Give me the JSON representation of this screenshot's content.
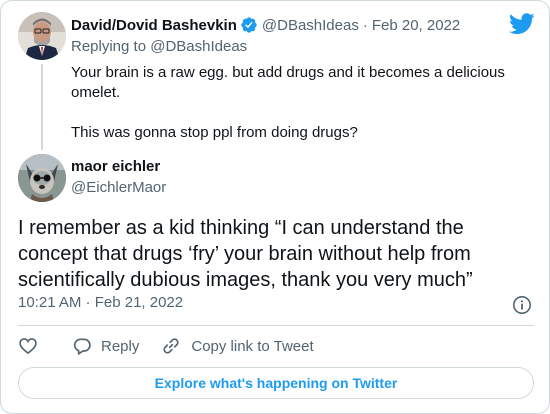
{
  "brand": {
    "icon": "twitter-bird-icon",
    "color": "#1d9bf0"
  },
  "parent_tweet": {
    "author_name": "David/Dovid Bashevkin",
    "verified_icon": "verified-badge-icon",
    "handle": "@DBashIdeas",
    "separator": "·",
    "date": "Feb 20, 2022",
    "replying_to": "Replying to @DBashIdeas",
    "paragraph_1": "Your brain is a raw egg. but add drugs and it becomes a delicious omelet.",
    "paragraph_2": "This was gonna stop ppl from doing drugs?"
  },
  "main_tweet": {
    "author_name": "maor eichler",
    "handle": "@EichlerMaor",
    "text": "I remember as a kid thinking “I can understand the concept that drugs ‘fry’ your brain without help from scientifically dubious images, thank you very much”",
    "timestamp": "10:21 AM · Feb 21, 2022"
  },
  "actions": {
    "like_icon": "heart-icon",
    "reply_icon": "reply-bubble-icon",
    "reply_label": "Reply",
    "copy_icon": "link-icon",
    "copy_label": "Copy link to Tweet",
    "info_icon": "info-icon"
  },
  "explore_button": {
    "label": "Explore what's happening on Twitter"
  }
}
